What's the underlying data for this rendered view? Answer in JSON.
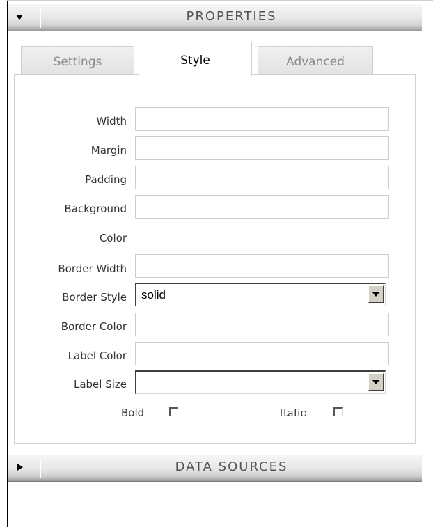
{
  "properties_panel": {
    "title": "PROPERTIES",
    "toggle_icon": "triangle-down-icon"
  },
  "tabs": [
    {
      "label": "Settings",
      "active": false
    },
    {
      "label": "Style",
      "active": true
    },
    {
      "label": "Advanced",
      "active": false
    }
  ],
  "style_form": {
    "width": {
      "label": "Width",
      "value": ""
    },
    "margin": {
      "label": "Margin",
      "value": ""
    },
    "padding": {
      "label": "Padding",
      "value": ""
    },
    "background": {
      "label": "Background",
      "value": ""
    },
    "color": {
      "label": "Color"
    },
    "border_width": {
      "label": "Border Width",
      "value": ""
    },
    "border_style": {
      "label": "Border Style",
      "value": "solid"
    },
    "border_color": {
      "label": "Border Color",
      "value": ""
    },
    "label_color": {
      "label": "Label Color",
      "value": ""
    },
    "label_size": {
      "label": "Label Size",
      "value": ""
    },
    "bold": {
      "label": "Bold",
      "checked": false
    },
    "italic": {
      "label": "Italic",
      "checked": false
    }
  },
  "data_sources_panel": {
    "title": "DATA SOURCES",
    "toggle_icon": "triangle-right-icon"
  }
}
